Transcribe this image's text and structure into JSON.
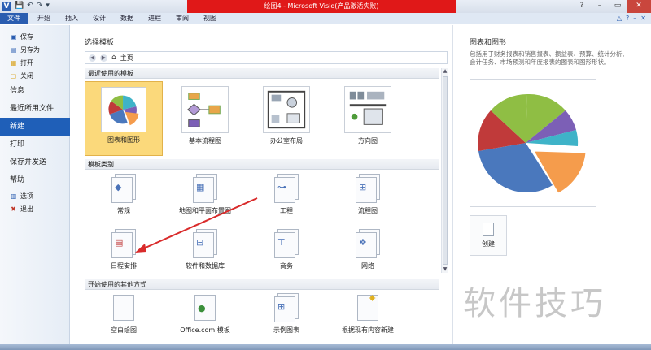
{
  "window": {
    "app_icon": "V",
    "title": "绘图4 - Microsoft Visio(产品激活失败)",
    "qat": [
      "💾",
      "↶",
      "↷",
      "▾"
    ],
    "controls": [
      "?",
      "–",
      "▭",
      "✕"
    ]
  },
  "ribbon": {
    "tabs": [
      "文件",
      "开始",
      "插入",
      "设计",
      "数据",
      "进程",
      "审阅",
      "视图"
    ],
    "right_icons": [
      "△",
      "?",
      "–",
      "✕"
    ]
  },
  "nav": {
    "small_top": [
      {
        "label": "保存",
        "icon": "save-icon",
        "glyph": "▣"
      },
      {
        "label": "另存为",
        "icon": "save-as-icon",
        "glyph": "▤"
      },
      {
        "label": "打开",
        "icon": "folder-open-icon",
        "glyph": "▦"
      },
      {
        "label": "关闭",
        "icon": "close-file-icon",
        "glyph": "▢"
      }
    ],
    "big": [
      "信息",
      "最近所用文件",
      "新建",
      "打印",
      "保存并发送",
      "帮助"
    ],
    "small_bottom": [
      {
        "label": "选项",
        "icon": "options-icon",
        "glyph": "▥"
      },
      {
        "label": "退出",
        "icon": "exit-icon",
        "glyph": "✖"
      }
    ]
  },
  "main": {
    "heading": "选择模板",
    "breadcrumb": {
      "back": "◀",
      "forward": "▶",
      "home_glyph": "⌂",
      "home_label": "主页"
    },
    "section_recent": "最近使用的模板",
    "recent": [
      "图表和图形",
      "基本流程图",
      "办公室布局",
      "方向图"
    ],
    "section_categories": "模板类别",
    "categories_row1": [
      "常规",
      "地图和平面布置图",
      "工程",
      "流程图"
    ],
    "categories_row2": [
      "日程安排",
      "软件和数据库",
      "商务",
      "网络"
    ],
    "section_other": "开始使用的其他方式",
    "other": [
      "空白绘图",
      "Office.com 模板",
      "示例图表",
      "根据现有内容新建"
    ],
    "scroll": {
      "up": "▲",
      "down": "▼"
    }
  },
  "preview": {
    "title": "图表和图形",
    "description": "包括用于财务报表和销售报表、损益表、预算、统计分析、会计任务、市场预测和年度报表的图表和图形形状。",
    "create_label": "创建",
    "watermark": "软件技巧"
  },
  "colors": {
    "file_tab": "#2a5db0",
    "nav_active": "#1f5fb8",
    "selected_tile": "#fbd97b",
    "title_strip": "#e01818",
    "pie": [
      "#4a78bd",
      "#f59c4c",
      "#3fb3c8",
      "#7c5fb6",
      "#8fbe44",
      "#c03a3a"
    ]
  }
}
